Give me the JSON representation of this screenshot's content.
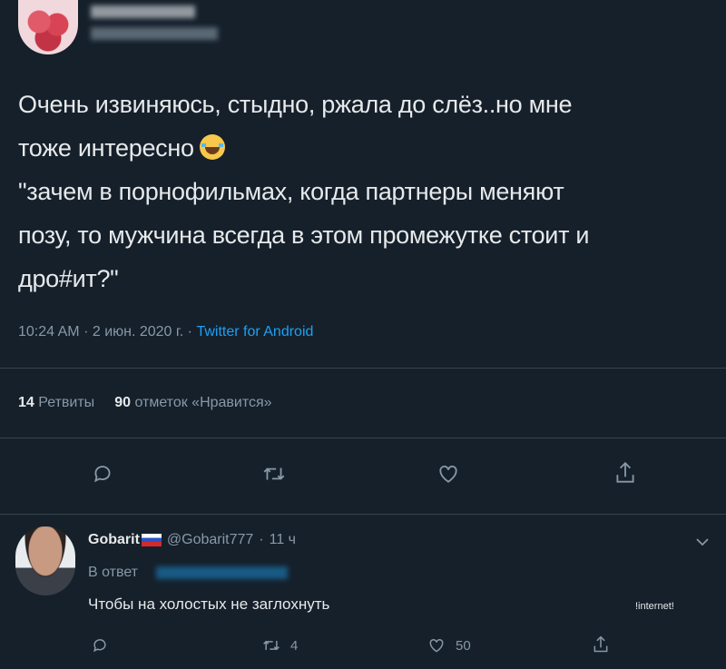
{
  "tweet": {
    "text_line1": "Очень извиняюсь, стыдно, ржала до слёз..но мне",
    "text_line2": "тоже интересно",
    "text_line3": "\"зачем в порнофильмах, когда партнеры меняют",
    "text_line4": "позу, то мужчина всегда в этом промежутке стоит и",
    "text_line5": "дро#ит?\"",
    "emoji": "face-with-tears-of-joy",
    "time": "10:24 AM",
    "date": "2 июн. 2020 г.",
    "separator": "·",
    "app": "Twitter for Android",
    "retweets_count": "14",
    "retweets_label": "Ретвиты",
    "likes_count": "90",
    "likes_label": "отметок «Нравится»"
  },
  "reply": {
    "name": "Gobarit",
    "handle": "@Gobarit777",
    "separator": "·",
    "time": "11 ч",
    "reply_to_label": "В ответ",
    "text": "Чтобы на холостых не заглохнуть",
    "retweet_count": "4",
    "like_count": "50"
  },
  "watermark": "!internet!",
  "icons": [
    "reply-icon",
    "retweet-icon",
    "like-icon",
    "share-icon",
    "chevron-down-icon"
  ],
  "colors": {
    "background": "#15202b",
    "text": "#e7e9ea",
    "secondary": "#8899a6",
    "accent": "#1da1f2",
    "divider": "#38444d"
  }
}
